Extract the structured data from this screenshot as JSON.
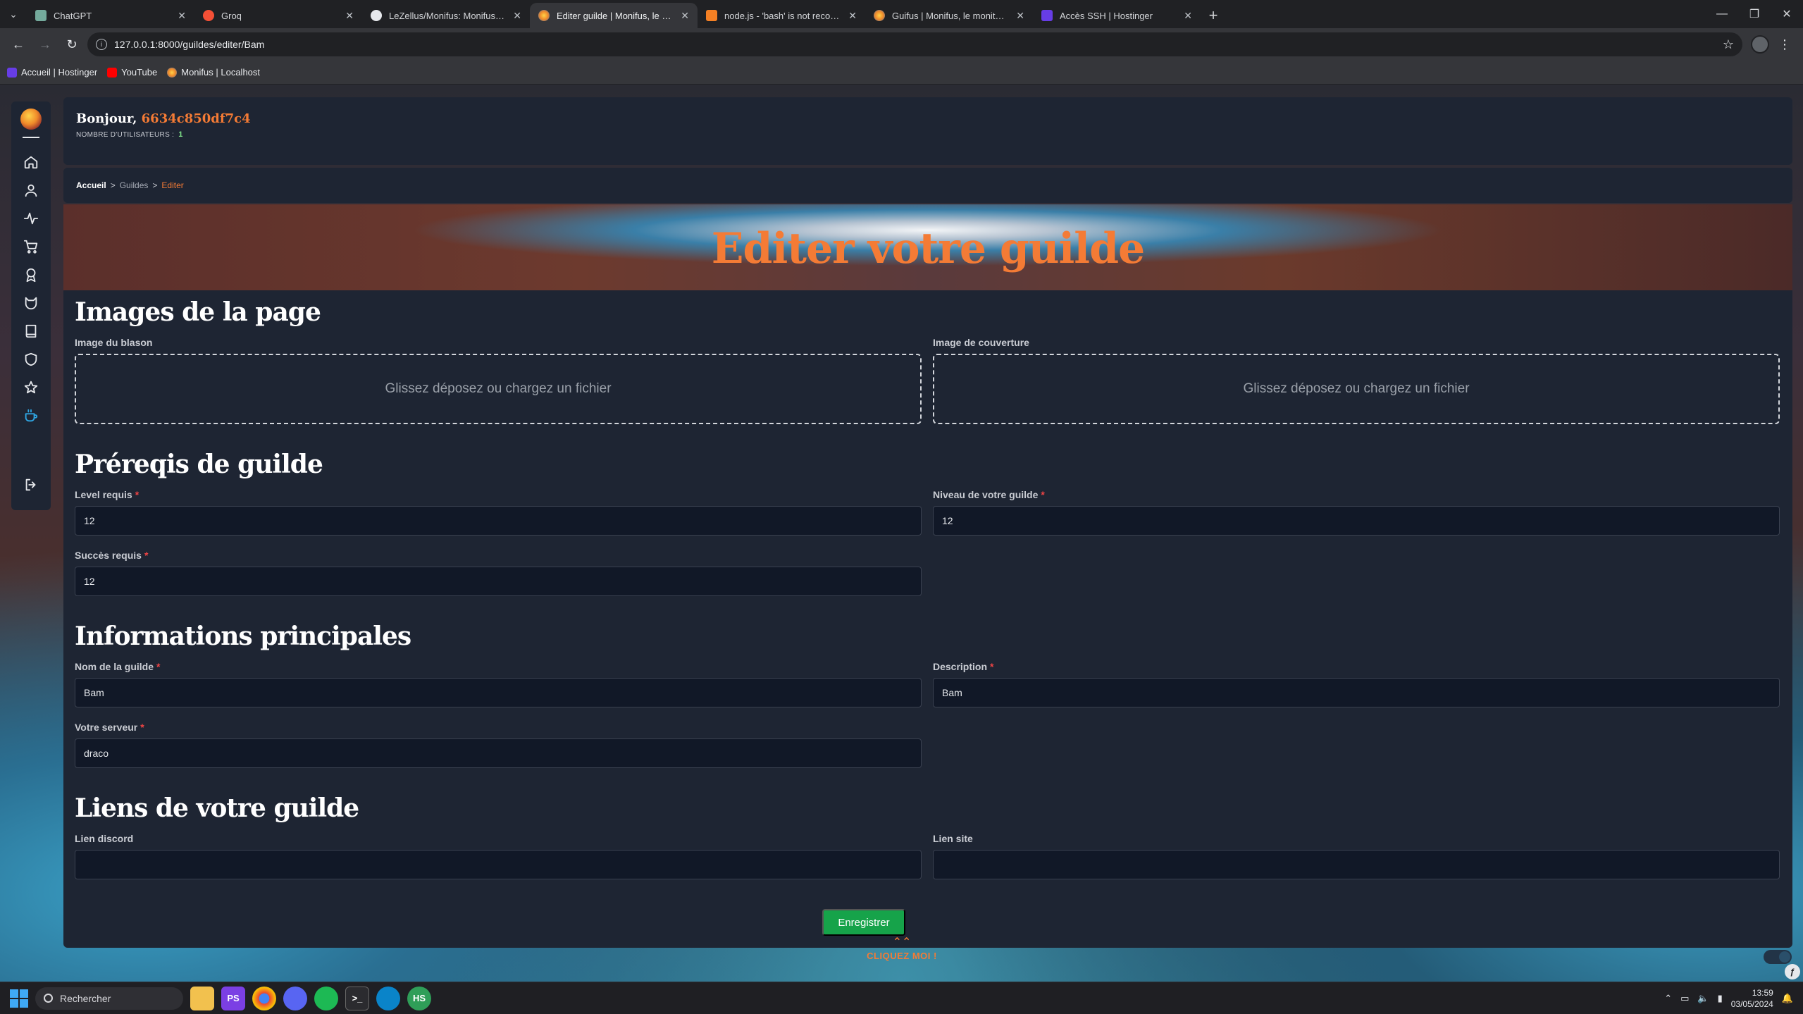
{
  "browser": {
    "tabs": [
      {
        "title": "ChatGPT",
        "color": "#74aa9c"
      },
      {
        "title": "Groq",
        "color": "#f55036"
      },
      {
        "title": "LeZellus/Monifus: Monifus, a m",
        "color": "#e6e8ec"
      },
      {
        "title": "Editer guilde | Monifus, le moni",
        "color": "#f08a2a"
      },
      {
        "title": "node.js - 'bash' is not recogniz",
        "color": "#f48024"
      },
      {
        "title": "Guifus | Monifus, le moniteur D",
        "color": "#f08a2a"
      },
      {
        "title": "Accès SSH | Hostinger",
        "color": "#673de6"
      }
    ],
    "active_tab": 3,
    "url": "127.0.0.1:8000/guildes/editer/Bam",
    "bookmarks": [
      {
        "label": "Accueil | Hostinger",
        "color": "#673de6"
      },
      {
        "label": "YouTube",
        "color": "#ff0000"
      },
      {
        "label": "Monifus | Localhost",
        "color": "#f08a2a"
      }
    ]
  },
  "header": {
    "greeting_prefix": "Bonjour,",
    "user_id": "6634c850df7c4",
    "users_label": "NOMBRE D'UTILISATEURS :",
    "users_count": "1"
  },
  "breadcrumb": {
    "home": "Accueil",
    "sep": ">",
    "section": "Guildes",
    "current": "Editer"
  },
  "hero": {
    "title": "Editer votre guilde"
  },
  "sections": {
    "images": "Images de la page",
    "prereq": "Préreqis de guilde",
    "info": "Informations principales",
    "links": "Liens de votre guilde"
  },
  "fields": {
    "blason_label": "Image du blason",
    "cover_label": "Image de couverture",
    "dropzone_text": "Glissez déposez ou chargez un fichier",
    "level_label": "Level requis",
    "level_value": "12",
    "guild_level_label": "Niveau de votre guilde",
    "guild_level_value": "12",
    "success_label": "Succès requis",
    "success_value": "12",
    "name_label": "Nom de la guilde",
    "name_value": "Bam",
    "desc_label": "Description",
    "desc_value": "Bam",
    "server_label": "Votre serveur",
    "server_value": "draco",
    "discord_label": "Lien discord",
    "discord_value": "",
    "site_label": "Lien site",
    "site_value": "",
    "required_mark": "*"
  },
  "actions": {
    "save": "Enregistrer",
    "cta_arrow": "⌃⌃",
    "cta_text": "CLIQUEZ MOI !"
  },
  "taskbar": {
    "search_placeholder": "Rechercher",
    "time": "13:59",
    "date": "03/05/2024"
  },
  "colors": {
    "accent": "#f47b35",
    "panel": "#1e2533",
    "input_bg": "#111827",
    "success": "#16a34a",
    "required": "#ef4444"
  }
}
